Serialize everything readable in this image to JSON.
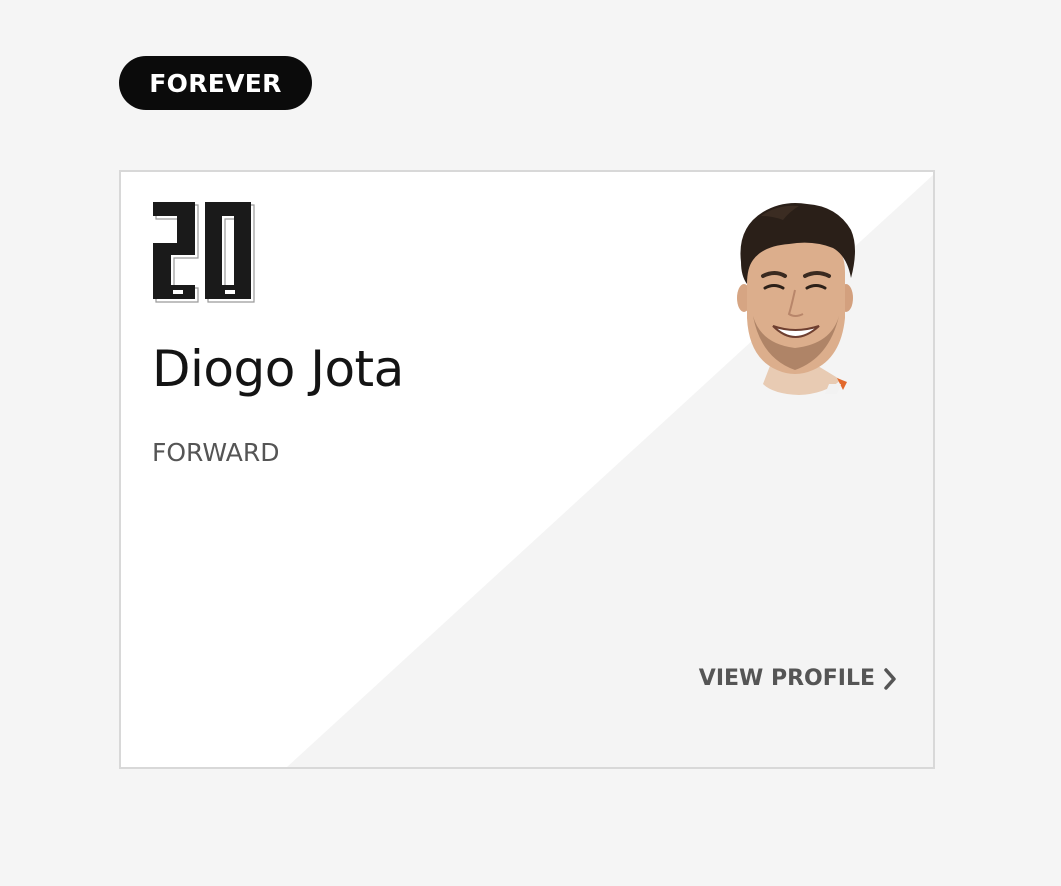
{
  "badge": {
    "label": "FOREVER"
  },
  "player": {
    "number": "20",
    "name": "Diogo Jota",
    "position": "FORWARD"
  },
  "card": {
    "cta_label": "VIEW PROFILE",
    "cta_icon": "chevron-right-icon"
  },
  "colors": {
    "page_background": "#f5f5f5",
    "badge_background": "#0b0b0b",
    "badge_text": "#ffffff",
    "card_light": "#ffffff",
    "card_shade": "#f4f4f4",
    "name_text": "#141414",
    "muted_text": "#555555"
  }
}
